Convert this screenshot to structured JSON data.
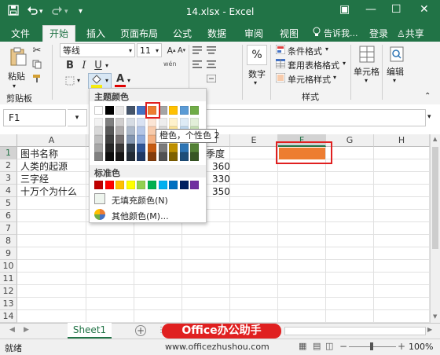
{
  "titlebar": {
    "title": "14.xlsx - Excel",
    "save_icon": "save-icon",
    "undo_icon": "undo-icon",
    "redo_icon": "redo-icon",
    "restore_glyph": "▣",
    "min_glyph": "—",
    "max_glyph": "☐",
    "close_glyph": "✕"
  },
  "tabs": {
    "file": "文件",
    "home": "开始",
    "insert": "插入",
    "layout": "页面布局",
    "formulas": "公式",
    "data": "数据",
    "review": "审阅",
    "view": "视图",
    "tell_me": "告诉我...",
    "login": "登录",
    "share": "共享"
  },
  "ribbon": {
    "paste_label": "粘贴",
    "clipboard_label": "剪贴板",
    "font_name": "等线",
    "font_size": "11",
    "bold": "B",
    "italic": "I",
    "underline": "U",
    "number_label": "数字",
    "percent": "%",
    "conditional": "条件格式",
    "table_format": "套用表格格式",
    "cell_style": "单元格样式",
    "styles_label": "样式",
    "cells_label": "单元格",
    "edit_label": "编辑",
    "wen": "wén",
    "fill_color": "#f6ec10",
    "font_color": "#e00000"
  },
  "formulabar": {
    "namebox": "F1",
    "fx": "fx"
  },
  "grid": {
    "columns": [
      "A",
      "B",
      "C",
      "D",
      "E",
      "F",
      "G",
      "H"
    ],
    "rows": [
      "1",
      "2",
      "3",
      "4",
      "5",
      "6",
      "7",
      "8",
      "9",
      "10",
      "11",
      "12",
      "13",
      "14"
    ],
    "colA": [
      "图书名称",
      "人类的起源",
      "三字经",
      "十万个为什么"
    ],
    "colD": [
      "季度",
      "360",
      "330",
      "350"
    ],
    "f1_fill": "#ed7d31"
  },
  "popup": {
    "theme_title": "主题颜色",
    "standard_title": "标准色",
    "no_fill": "无填充颜色(N)",
    "more_colors": "其他颜色(M)...",
    "tooltip": "橙色，个性色 2",
    "theme_top": [
      "#ffffff",
      "#000000",
      "#e7e6e6",
      "#44546a",
      "#4472c4",
      "#ed7d31",
      "#a5a5a5",
      "#ffc000",
      "#5b9bd5",
      "#70ad47"
    ],
    "theme_shades": [
      [
        "#f2f2f2",
        "#7f7f7f",
        "#d0cece",
        "#d6dce4",
        "#d9e2f3",
        "#fbe5d5",
        "#ededed",
        "#fff2cc",
        "#deebf6",
        "#e2efd9"
      ],
      [
        "#d9d9d9",
        "#595959",
        "#aeabab",
        "#adb9ca",
        "#b4c6e7",
        "#f7cbac",
        "#dbdbdb",
        "#fee599",
        "#bdd7ee",
        "#c5e0b3"
      ],
      [
        "#bfbfbf",
        "#404040",
        "#757070",
        "#8496b0",
        "#8eaadb",
        "#f4b183",
        "#c9c9c9",
        "#ffd965",
        "#9cc3e5",
        "#a8d08d"
      ],
      [
        "#a6a6a6",
        "#262626",
        "#3a3838",
        "#323f4f",
        "#2f5496",
        "#c55a11",
        "#7b7b7b",
        "#bf9000",
        "#2e75b5",
        "#538135"
      ],
      [
        "#808080",
        "#0d0d0d",
        "#171616",
        "#222a35",
        "#1f3864",
        "#833c0b",
        "#525252",
        "#7f6000",
        "#1e4e79",
        "#375623"
      ]
    ],
    "standard": [
      "#c00000",
      "#ff0000",
      "#ffc000",
      "#ffff00",
      "#92d050",
      "#00b050",
      "#00b0f0",
      "#0070c0",
      "#002060",
      "#7030a0"
    ]
  },
  "sheets": {
    "sheet1": "Sheet1",
    "add": "+"
  },
  "status": {
    "ready": "就绪",
    "zoom": "100%",
    "zoom_minus": "−",
    "zoom_plus": "+"
  },
  "watermark": {
    "brand": "Office办公助手",
    "url": "www.officezhushou.com"
  },
  "colors": {
    "excel_green": "#217346",
    "highlight_red": "#e02020"
  }
}
